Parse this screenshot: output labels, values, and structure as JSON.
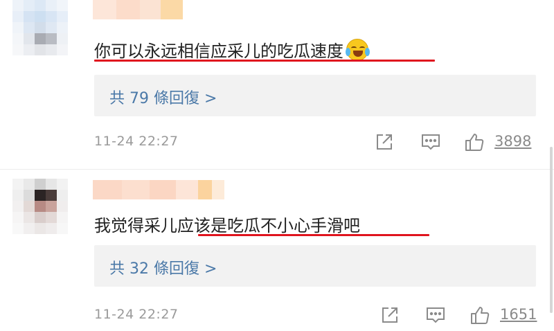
{
  "comments": [
    {
      "text": "你可以永远相信应采儿的吃瓜速度",
      "emoji_icon": "laughing-crying-emoji",
      "replies_label": "共 79 條回復 >",
      "timestamp": "11-24 22:27",
      "likes": "3898"
    },
    {
      "text": "我觉得采儿应该是吃瓜不小心手滑吧",
      "replies_label": "共 32 條回復 >",
      "timestamp": "11-24 22:27",
      "likes": "1651"
    }
  ],
  "colors": {
    "highlight_underline": "#e0141e",
    "reply_link": "#4b79a8",
    "reply_box_bg": "#f2f2f2",
    "meta_gray": "#9a9a9a"
  }
}
